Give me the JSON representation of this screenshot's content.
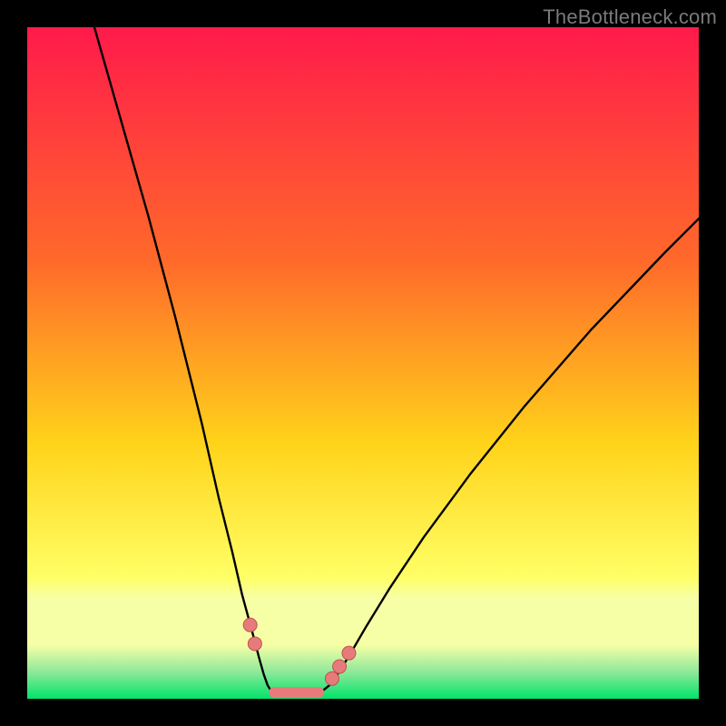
{
  "watermark": "TheBottleneck.com",
  "colors": {
    "gradient_top": "#ff1a4b",
    "gradient_mid1": "#ff6a2a",
    "gradient_mid2": "#ffd31a",
    "gradient_mid3": "#ffff66",
    "gradient_bottom_band_light": "#f6ffa6",
    "gradient_bottom_band_green": "#00e46a",
    "curve_stroke": "#000000",
    "marker_fill": "#e77b7b",
    "marker_stroke": "#c05050",
    "frame": "#000000"
  },
  "chart_data": {
    "type": "line",
    "title": "",
    "xlabel": "",
    "ylabel": "",
    "xlim": [
      0,
      100
    ],
    "ylim": [
      0,
      100
    ],
    "grid": false,
    "series": [
      {
        "name": "curve-left",
        "x": [
          10,
          14,
          18,
          22,
          26,
          28.5,
          30.5,
          32,
          33.5,
          34.5,
          35.2,
          35.8,
          36.3
        ],
        "y": [
          100,
          86,
          72,
          57,
          41,
          30,
          22,
          15.5,
          10,
          6.2,
          3.7,
          2,
          1.2
        ]
      },
      {
        "name": "valley-floor",
        "x": [
          36.3,
          37.5,
          38.8,
          40.2,
          41.5,
          42.8,
          44.0
        ],
        "y": [
          1.2,
          0.9,
          0.85,
          0.85,
          0.9,
          1.0,
          1.2
        ]
      },
      {
        "name": "curve-right",
        "x": [
          44.0,
          45.0,
          46.3,
          48.0,
          50.5,
          54,
          59,
          66,
          74,
          84,
          95,
          100
        ],
        "y": [
          1.2,
          2.0,
          3.8,
          6.5,
          10.8,
          16.5,
          24,
          33.5,
          43.5,
          55,
          66.5,
          71.5
        ]
      }
    ],
    "markers_left": [
      {
        "x": 33.2,
        "y": 11.0
      },
      {
        "x": 33.9,
        "y": 8.2
      }
    ],
    "markers_right": [
      {
        "x": 45.4,
        "y": 3.0
      },
      {
        "x": 46.5,
        "y": 4.8
      },
      {
        "x": 47.9,
        "y": 6.8
      }
    ],
    "floor_segment": {
      "x": [
        36.8,
        43.4
      ],
      "y": [
        0.95,
        0.95
      ]
    }
  }
}
